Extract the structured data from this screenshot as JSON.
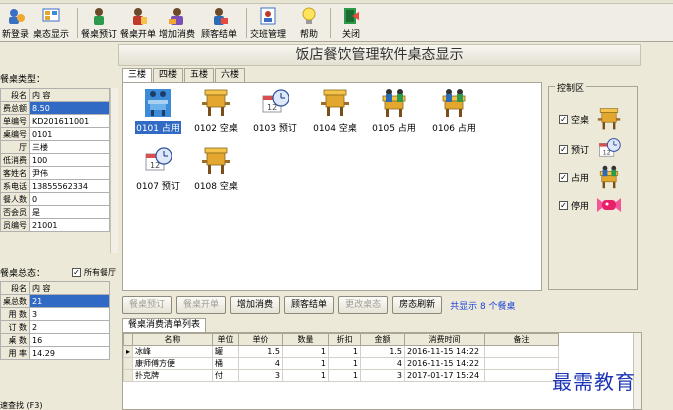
{
  "toolbar": {
    "buttons": [
      {
        "label": "新登录",
        "icon": "login-icon"
      },
      {
        "label": "桌态显示",
        "icon": "table-status-icon"
      },
      {
        "label": "餐桌预订",
        "icon": "reserve-icon"
      },
      {
        "label": "餐桌开单",
        "icon": "open-order-icon"
      },
      {
        "label": "增加消费",
        "icon": "add-consumption-icon"
      },
      {
        "label": "顾客结单",
        "icon": "checkout-icon"
      },
      {
        "label": "交班管理",
        "icon": "shift-icon"
      },
      {
        "label": "帮助",
        "icon": "help-bulb-icon"
      },
      {
        "label": "关闭",
        "icon": "exit-icon"
      }
    ]
  },
  "title": "饭店餐饮管理软件桌态显示",
  "left": {
    "table_type_label": "餐桌类型：",
    "details_header": {
      "k": "段名",
      "v": "内 容"
    },
    "details": [
      {
        "k": "费总额",
        "v": "8.50"
      },
      {
        "k": "单编号",
        "v": "KD201611001"
      },
      {
        "k": "桌编号",
        "v": "0101"
      },
      {
        "k": "厅",
        "v": "三楼"
      },
      {
        "k": "低消费",
        "v": "100"
      },
      {
        "k": "客姓名",
        "v": "尹伟"
      },
      {
        "k": "系电话",
        "v": "13855562334"
      },
      {
        "k": "餐人数",
        "v": "0"
      },
      {
        "k": "否会员",
        "v": "是"
      },
      {
        "k": "员编号",
        "v": "21001"
      }
    ],
    "summary_label": "餐桌总态：",
    "all_halls_label": "所有餐厅",
    "summary_header": {
      "k": "段名",
      "v": "内 容"
    },
    "summary": [
      {
        "k": "桌总数",
        "v": "21"
      },
      {
        "k": "用 数",
        "v": "3"
      },
      {
        "k": "订 数",
        "v": "2"
      },
      {
        "k": "桌 数",
        "v": "16"
      },
      {
        "k": "用 率",
        "v": "14.29"
      }
    ],
    "quick_search_label": "速查找 (F3)"
  },
  "floors": [
    "三楼",
    "四楼",
    "五楼",
    "六楼"
  ],
  "tables": [
    {
      "label": "0101 占用",
      "status": "occupied",
      "selected": true
    },
    {
      "label": "0102 空桌",
      "status": "empty"
    },
    {
      "label": "0103 预订",
      "status": "reserved"
    },
    {
      "label": "0104 空桌",
      "status": "empty"
    },
    {
      "label": "0105 占用",
      "status": "occupied"
    },
    {
      "label": "0106 占用",
      "status": "occupied"
    },
    {
      "label": "0107 预订",
      "status": "reserved"
    },
    {
      "label": "0108 空桌",
      "status": "empty"
    }
  ],
  "control": {
    "title": "控制区",
    "items": [
      {
        "label": "空桌",
        "checked": "✓",
        "icon": "empty-table-icon"
      },
      {
        "label": "预订",
        "checked": "✓",
        "icon": "reserved-clock-icon"
      },
      {
        "label": "占用",
        "checked": "✓",
        "icon": "occupied-table-icon"
      },
      {
        "label": "停用",
        "checked": "✓",
        "icon": "disabled-candy-icon"
      }
    ]
  },
  "actions": {
    "reserve": "餐桌预订",
    "open": "餐桌开单",
    "add": "增加消费",
    "checkout": "顾客结单",
    "change": "更改桌态",
    "refresh": "房态刷新",
    "count_text": "共显示 8 个餐桌"
  },
  "orders": {
    "tab": "餐桌消费清单列表",
    "columns": [
      "名称",
      "单位",
      "单价",
      "数量",
      "折扣",
      "金额",
      "消费时间",
      "备注"
    ],
    "rows": [
      {
        "name": "冰峰",
        "unit": "罐",
        "price": "1.5",
        "qty": "1",
        "discount": "1",
        "amount": "1.5",
        "time": "2016-11-15 14:22",
        "note": ""
      },
      {
        "name": "康师傅方便",
        "unit": "桶",
        "price": "4",
        "qty": "1",
        "discount": "1",
        "amount": "4",
        "time": "2016-11-15 14:22",
        "note": ""
      },
      {
        "name": "扑克牌",
        "unit": "付",
        "price": "3",
        "qty": "1",
        "discount": "1",
        "amount": "3",
        "time": "2017-01-17 15:24",
        "note": ""
      }
    ]
  },
  "watermark": "最需教育",
  "colors": {
    "selection": "#316ac5",
    "count_text": "#1a3fd8",
    "watermark": "#1e34b8"
  }
}
